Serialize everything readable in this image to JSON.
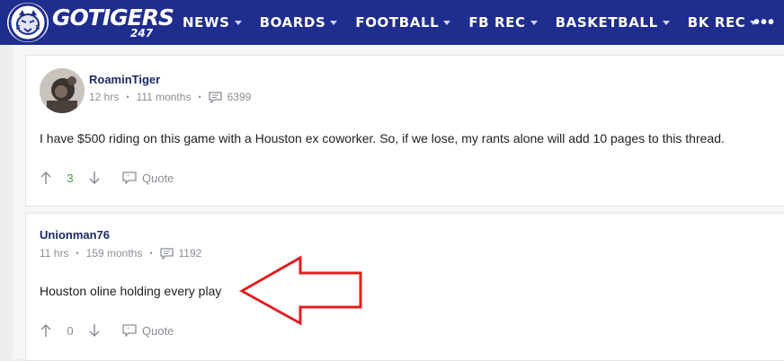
{
  "site": {
    "logo_text": "GOTIGERS",
    "logo_sub": "247",
    "nav_items": [
      "NEWS",
      "BOARDS",
      "FOOTBALL",
      "FB REC",
      "BASKETBALL",
      "BK REC"
    ],
    "more_label": "•••"
  },
  "posts": [
    {
      "username": "RoaminTiger",
      "time": "12 hrs",
      "tenure": "111 months",
      "post_count": "6399",
      "body": "I have $500 riding on this game with a Houston ex coworker. So, if we lose, my rants alone will add 10 pages to this thread.",
      "votes": "3",
      "quote_label": "Quote"
    },
    {
      "username": "Unionman76",
      "time": "11 hrs",
      "tenure": "159 months",
      "post_count": "1192",
      "body": "Houston oline holding every play",
      "votes": "0",
      "quote_label": "Quote"
    }
  ],
  "annotation": {
    "color": "#e02020",
    "icon": "left-arrow-outline"
  },
  "colors": {
    "nav_bg": "#1f2d8f",
    "username": "#1a2a6c",
    "vote_positive": "#3aa142"
  }
}
